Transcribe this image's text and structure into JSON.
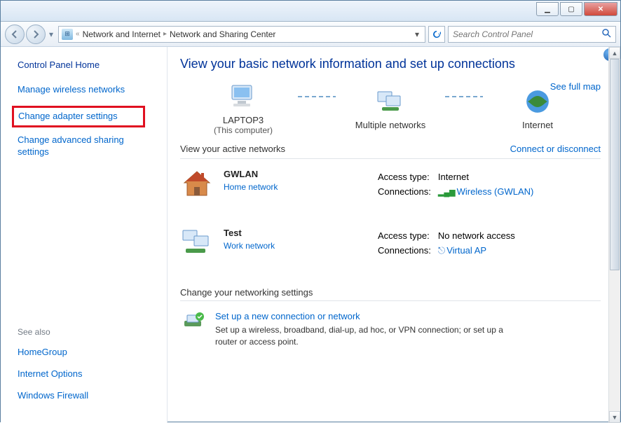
{
  "address": {
    "parent": "Network and Internet",
    "current": "Network and Sharing Center",
    "chevron_parent": "«"
  },
  "search": {
    "placeholder": "Search Control Panel"
  },
  "sidebar": {
    "home": "Control Panel Home",
    "links": [
      "Manage wireless networks",
      "Change adapter settings",
      "Change advanced sharing settings"
    ],
    "see_also_label": "See also",
    "see_also": [
      "HomeGroup",
      "Internet Options",
      "Windows Firewall"
    ]
  },
  "content": {
    "heading": "View your basic network information and set up connections",
    "full_map": "See full map",
    "map": {
      "node1": "LAPTOP3",
      "node1_sub": "(This computer)",
      "node2": "Multiple networks",
      "node3": "Internet"
    },
    "active_label": "View your active networks",
    "connect_link": "Connect or disconnect",
    "networks": [
      {
        "name": "GWLAN",
        "type": "Home network",
        "access_label": "Access type:",
        "access_value": "Internet",
        "conn_label": "Connections:",
        "conn_value": "Wireless (GWLAN)",
        "icon": "house"
      },
      {
        "name": "Test",
        "type": "Work network",
        "access_label": "Access type:",
        "access_value": "No network access",
        "conn_label": "Connections:",
        "conn_value": "Virtual AP",
        "icon": "monitors"
      }
    ],
    "change_label": "Change your networking settings",
    "setup": {
      "title": "Set up a new connection or network",
      "desc": "Set up a wireless, broadband, dial-up, ad hoc, or VPN connection; or set up a router or access point."
    }
  }
}
